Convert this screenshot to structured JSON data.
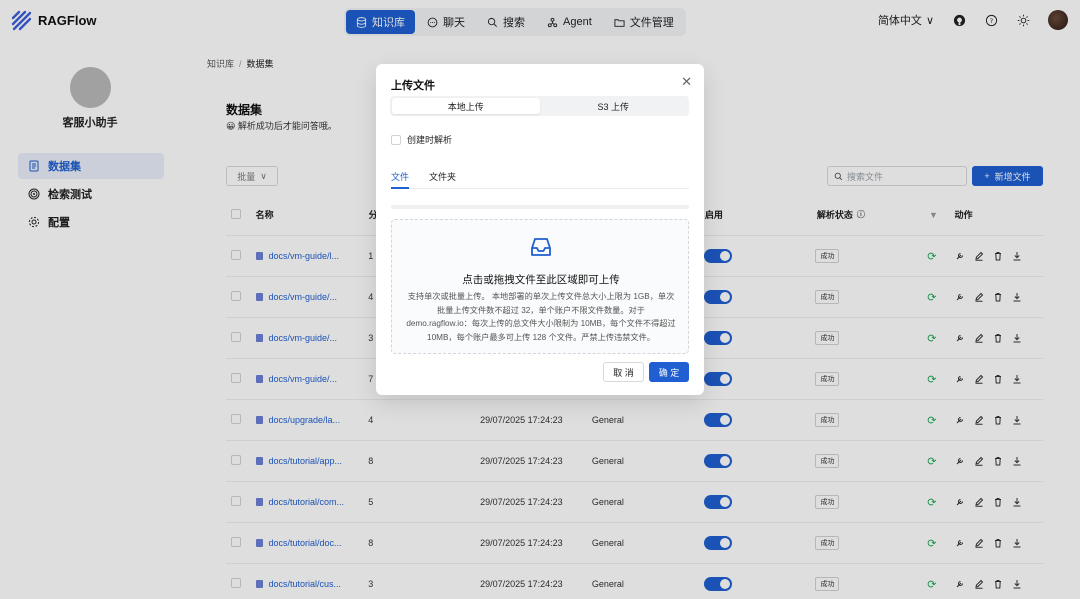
{
  "app": {
    "name": "RAGFlow"
  },
  "nav": {
    "items": [
      {
        "label": "知识库",
        "icon": "database-icon",
        "active": true
      },
      {
        "label": "聊天",
        "icon": "chat-icon",
        "active": false
      },
      {
        "label": "搜索",
        "icon": "search-icon",
        "active": false
      },
      {
        "label": "Agent",
        "icon": "agent-icon",
        "active": false
      },
      {
        "label": "文件管理",
        "icon": "folder-icon",
        "active": false
      }
    ],
    "language": "简体中文"
  },
  "sidebar": {
    "name": "客服小助手",
    "items": [
      {
        "label": "数据集",
        "icon": "document-icon",
        "active": true
      },
      {
        "label": "检索测试",
        "icon": "target-icon",
        "active": false
      },
      {
        "label": "配置",
        "icon": "gear-icon",
        "active": false
      }
    ]
  },
  "breadcrumb": {
    "root": "知识库",
    "current": "数据集"
  },
  "page": {
    "title": "数据集",
    "subtitle": "😀 解析成功后才能问答哦。",
    "bulk_label": "批量",
    "search_placeholder": "搜索文件",
    "add_label": "新增文件"
  },
  "table": {
    "headers": {
      "name": "名称",
      "chunks": "分",
      "enable": "启用",
      "status": "解析状态",
      "actions": "动作"
    },
    "rows": [
      {
        "name": "docs/vm-guide/l...",
        "chunks": "1",
        "date": "",
        "method": "",
        "status": "成功"
      },
      {
        "name": "docs/vm-guide/...",
        "chunks": "4",
        "date": "",
        "method": "",
        "status": "成功"
      },
      {
        "name": "docs/vm-guide/...",
        "chunks": "3",
        "date": "",
        "method": "",
        "status": "成功"
      },
      {
        "name": "docs/vm-guide/...",
        "chunks": "7",
        "date": "",
        "method": "",
        "status": "成功"
      },
      {
        "name": "docs/upgrade/la...",
        "chunks": "4",
        "date": "29/07/2025 17:24:23",
        "method": "General",
        "status": "成功"
      },
      {
        "name": "docs/tutorial/app...",
        "chunks": "8",
        "date": "29/07/2025 17:24:23",
        "method": "General",
        "status": "成功"
      },
      {
        "name": "docs/tutorial/com...",
        "chunks": "5",
        "date": "29/07/2025 17:24:23",
        "method": "General",
        "status": "成功"
      },
      {
        "name": "docs/tutorial/doc...",
        "chunks": "8",
        "date": "29/07/2025 17:24:23",
        "method": "General",
        "status": "成功"
      },
      {
        "name": "docs/tutorial/cus...",
        "chunks": "3",
        "date": "29/07/2025 17:24:23",
        "method": "General",
        "status": "成功"
      }
    ]
  },
  "modal": {
    "title": "上传文件",
    "segments": [
      "本地上传",
      "S3 上传"
    ],
    "parse_on_create": "创建时解析",
    "tabs": [
      "文件",
      "文件夹"
    ],
    "drop_title": "点击或拖拽文件至此区域即可上传",
    "drop_desc": "支持单次或批量上传。 本地部署的单次上传文件总大小上限为 1GB，单次批量上传文件数不超过 32，单个账户不限文件数量。对于 demo.ragflow.io：每次上传的总文件大小限制为 10MB，每个文件不得超过 10MB，每个账户最多可上传 128 个文件。严禁上传违禁文件。",
    "cancel": "取 消",
    "ok": "确 定"
  },
  "colors": {
    "primary": "#1f5fd1",
    "success": "#22a85a"
  }
}
